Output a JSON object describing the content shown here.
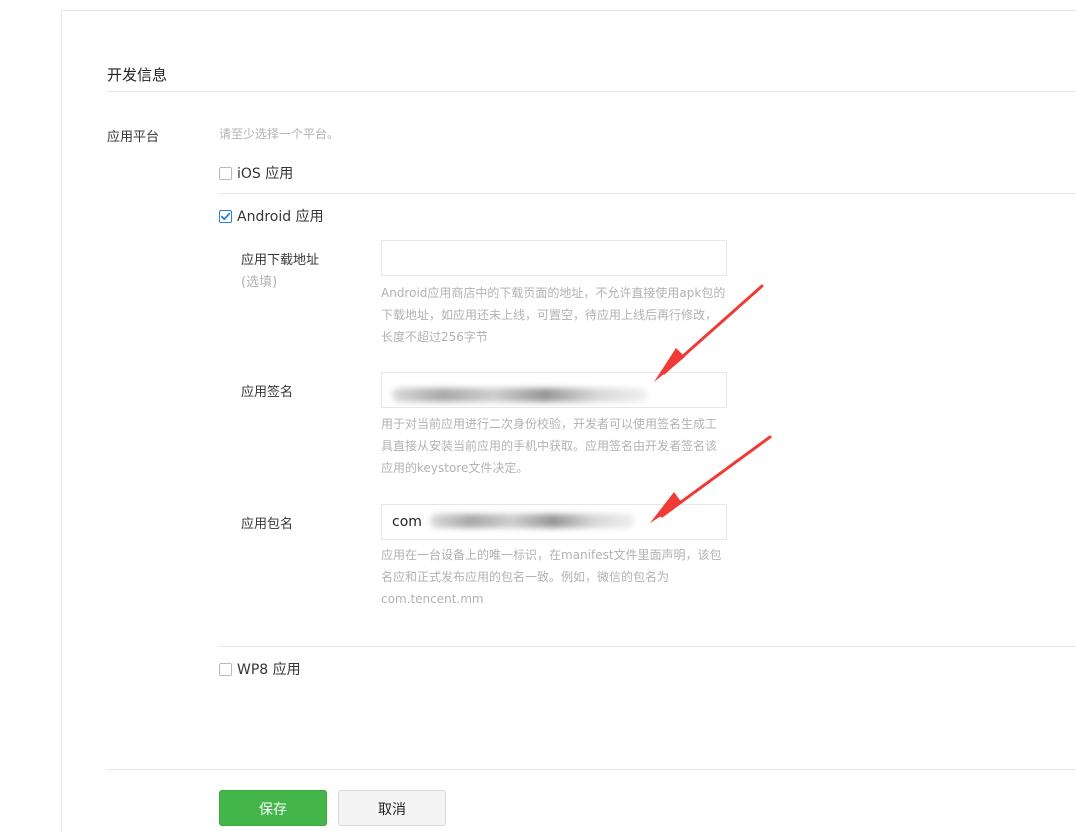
{
  "section": {
    "title": "开发信息"
  },
  "platform": {
    "label": "应用平台",
    "hint": "请至少选择一个平台。",
    "options": [
      {
        "label": "iOS 应用",
        "checked": false
      },
      {
        "label": "Android 应用",
        "checked": true
      },
      {
        "label": "WP8 应用",
        "checked": false
      }
    ]
  },
  "android": {
    "download_url": {
      "label": "应用下载地址",
      "sublabel": "(选填)",
      "value": "",
      "hint": "Android应用商店中的下载页面的地址，不允许直接使用apk包的下载地址，如应用还未上线，可置空，待应用上线后再行修改，长度不超过256字节"
    },
    "signature": {
      "label": "应用签名",
      "hint": "用于对当前应用进行二次身份校验，开发者可以使用签名生成工具直接从安装当前应用的手机中获取。应用签名由开发者签名该应用的keystore文件决定。"
    },
    "package": {
      "label": "应用包名",
      "value_prefix": "com",
      "hint": "应用在一台设备上的唯一标识，在manifest文件里面声明，该包名应和正式发布应用的包名一致。例如，微信的包名为com.tencent.mm"
    }
  },
  "actions": {
    "save_label": "保存",
    "cancel_label": "取消"
  },
  "colors": {
    "primary_button": "#44b549",
    "annotation_arrow": "#ee3b36",
    "hint_text": "#b2b2b2",
    "checkbox_checked": "#2b7fd6"
  }
}
